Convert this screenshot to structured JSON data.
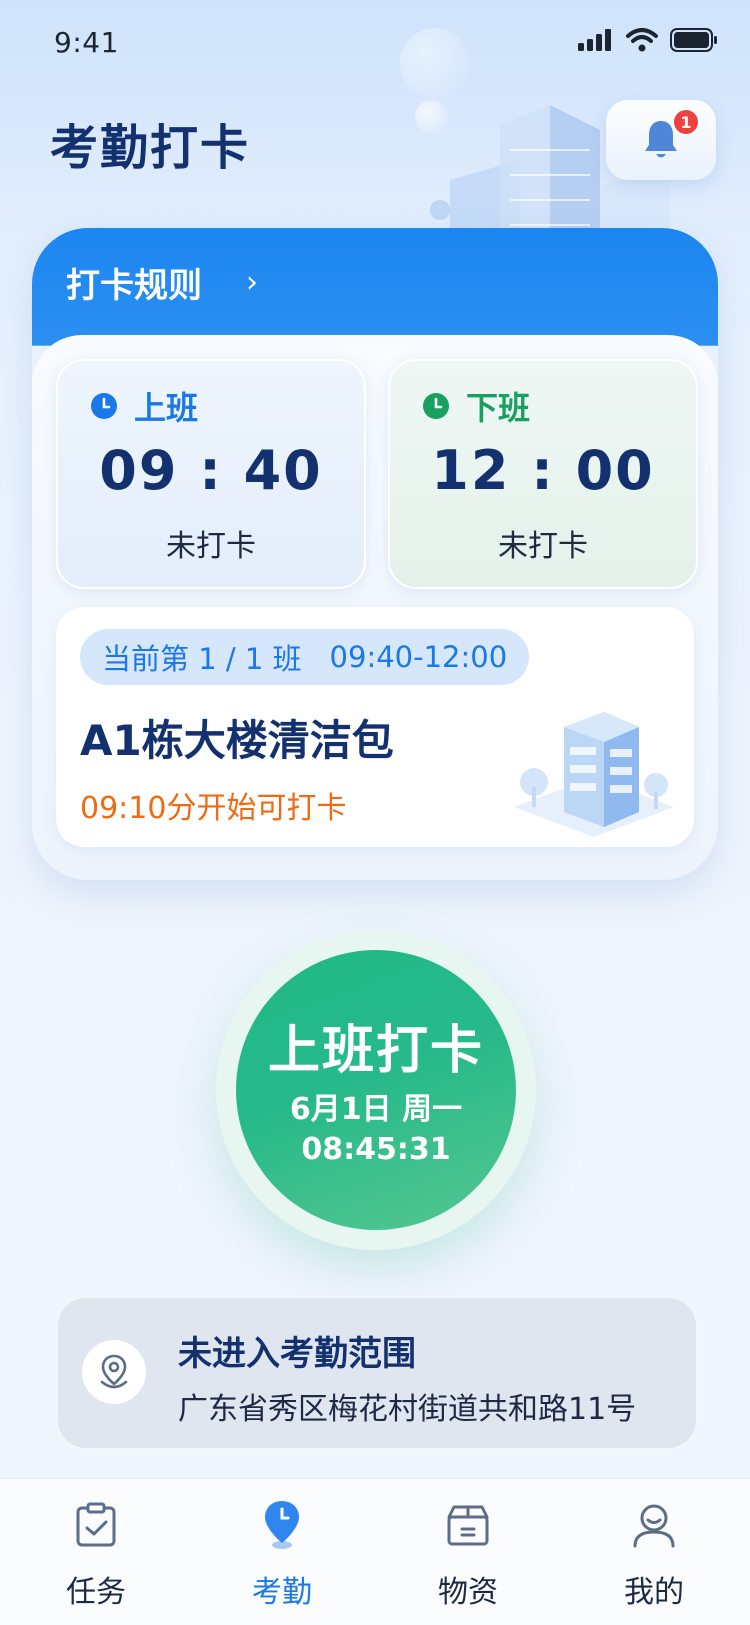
{
  "status_bar": {
    "time": "9:41"
  },
  "header": {
    "title": "考勤打卡",
    "notification_count": "1"
  },
  "rules_card": {
    "rules_link": "打卡规则",
    "shifts": [
      {
        "label": "上班",
        "time": "09 : 40",
        "status": "未打卡",
        "color": "#1a78e8"
      },
      {
        "label": "下班",
        "time": "12 : 00",
        "status": "未打卡",
        "color": "#18a060"
      }
    ],
    "current_shift": {
      "index_text": "当前第 1 / 1 班",
      "time_range": "09:40-12:00",
      "task_name": "A1栋大楼清洁包",
      "note": "09:10分开始可打卡"
    }
  },
  "punch_button": {
    "label": "上班打卡",
    "date": "6月1日 周一",
    "clock": "08:45:31"
  },
  "location": {
    "title": "未进入考勤范围",
    "address": "广东省秀区梅花村街道共和路11号"
  },
  "tabs": [
    {
      "label": "任务",
      "icon": "clipboard-check-icon",
      "active": false
    },
    {
      "label": "考勤",
      "icon": "location-clock-icon",
      "active": true
    },
    {
      "label": "物资",
      "icon": "box-icon",
      "active": false
    },
    {
      "label": "我的",
      "icon": "user-icon",
      "active": false
    }
  ],
  "colors": {
    "primary": "#1a78e8",
    "success": "#18a060",
    "warning": "#f06a12",
    "title": "#13316f"
  }
}
